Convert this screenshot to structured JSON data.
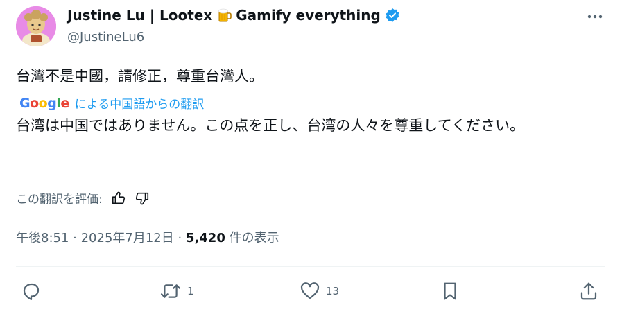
{
  "author": {
    "display_name": "Justine Lu | Lootex",
    "name_suffix": "Gamify everything",
    "handle": "@JustineLu6",
    "verified": true,
    "beer_icon": "beer-mug-icon"
  },
  "tweet": {
    "text": "台灣不是中國，請修正，尊重台灣人。"
  },
  "translation": {
    "google_label": "Google",
    "link_text": "による中国語からの翻訳",
    "text": "台湾は中国ではありません。この点を正し、台湾の人々を尊重してください。"
  },
  "rating": {
    "label": "この翻訳を評価:"
  },
  "meta": {
    "time_date": "午後8:51 · 2025年7月12日 · ",
    "views": "5,420",
    "views_suffix": " 件の表示"
  },
  "actions": {
    "replies": "",
    "retweets": "1",
    "likes": "13"
  },
  "colors": {
    "text": "#0f1419",
    "secondary": "#536471",
    "accent": "#1d9bf0",
    "avatar_bg": "#e88be6"
  }
}
